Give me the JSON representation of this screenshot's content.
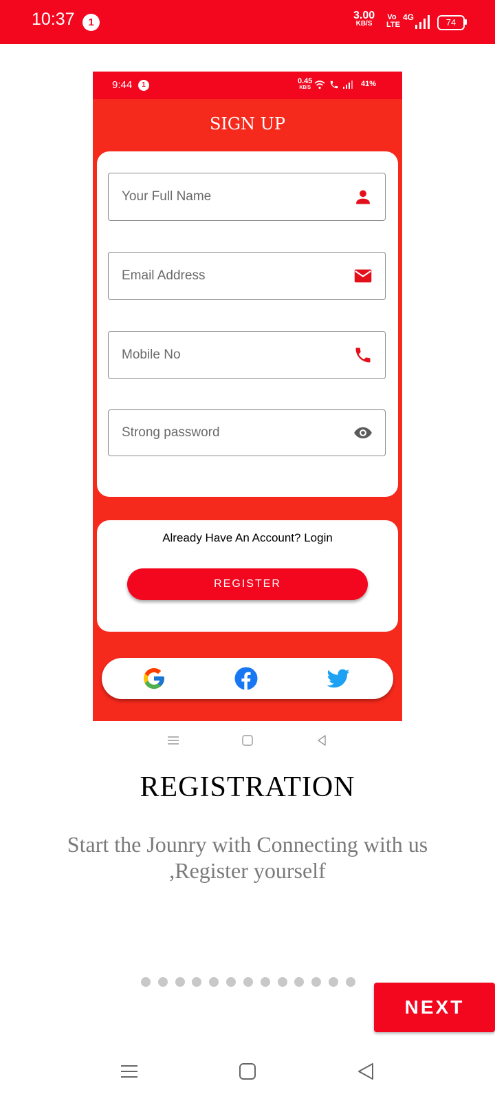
{
  "status_bar": {
    "time": "10:37",
    "notification_count": "1",
    "net_speed": "3.00",
    "net_speed_unit": "KB/S",
    "volte": "Vo LTE",
    "network": "4G",
    "battery": "74"
  },
  "embedded_screen": {
    "status_bar": {
      "time": "9:44",
      "notification_count": "1",
      "net_speed": "0.45",
      "net_speed_unit": "KB/S",
      "battery": "41%"
    },
    "title": "SIGN UP",
    "fields": [
      {
        "placeholder": "Your Full Name",
        "icon": "person-icon"
      },
      {
        "placeholder": "Email Address",
        "icon": "mail-icon"
      },
      {
        "placeholder": "Mobile No",
        "icon": "phone-icon"
      },
      {
        "placeholder": "Strong password",
        "icon": "eye-icon"
      }
    ],
    "login_prompt": "Already Have An Account? Login",
    "register_label": "REGISTER",
    "social": [
      "google-icon",
      "facebook-icon",
      "twitter-icon"
    ]
  },
  "onboarding": {
    "title": "REGISTRATION",
    "description": "Start the Jounry with Connecting with us ,Register yourself",
    "page_count": 13,
    "next_label": "NEXT"
  },
  "colors": {
    "brand_red": "#f2071f",
    "inner_background": "#f5291c",
    "dot_inactive": "#c8c8c8"
  }
}
